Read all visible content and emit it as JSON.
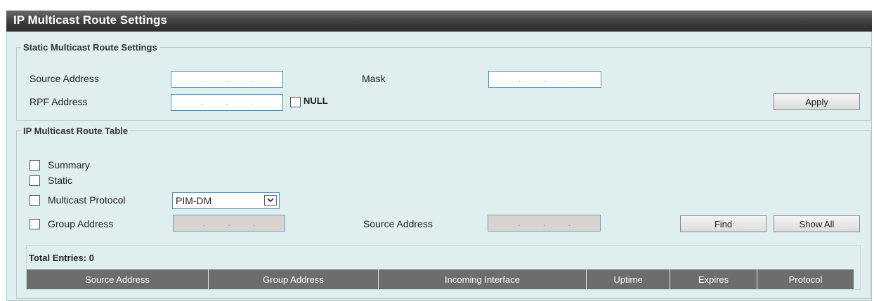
{
  "page_title": "IP Multicast Route Settings",
  "static_section": {
    "legend": "Static Multicast Route Settings",
    "source_address_label": "Source Address",
    "mask_label": "Mask",
    "rpf_address_label": "RPF Address",
    "null_label": "NULL",
    "null_checked": false,
    "ip_separator": ".",
    "apply_label": "Apply"
  },
  "table_section": {
    "legend": "IP Multicast Route Table",
    "summary_label": "Summary",
    "static_label": "Static",
    "multicast_protocol_label": "Multicast Protocol",
    "multicast_protocol_value": "PIM-DM",
    "group_address_label": "Group Address",
    "source_address_label": "Source Address",
    "find_label": "Find",
    "show_all_label": "Show All",
    "total_entries": "Total Entries: 0",
    "columns": [
      "Source Address",
      "Group Address",
      "Incoming Interface",
      "Uptime",
      "Expires",
      "Protocol"
    ],
    "rows": []
  },
  "icons": {
    "dropdown_arrow": "chevron-down-icon"
  }
}
